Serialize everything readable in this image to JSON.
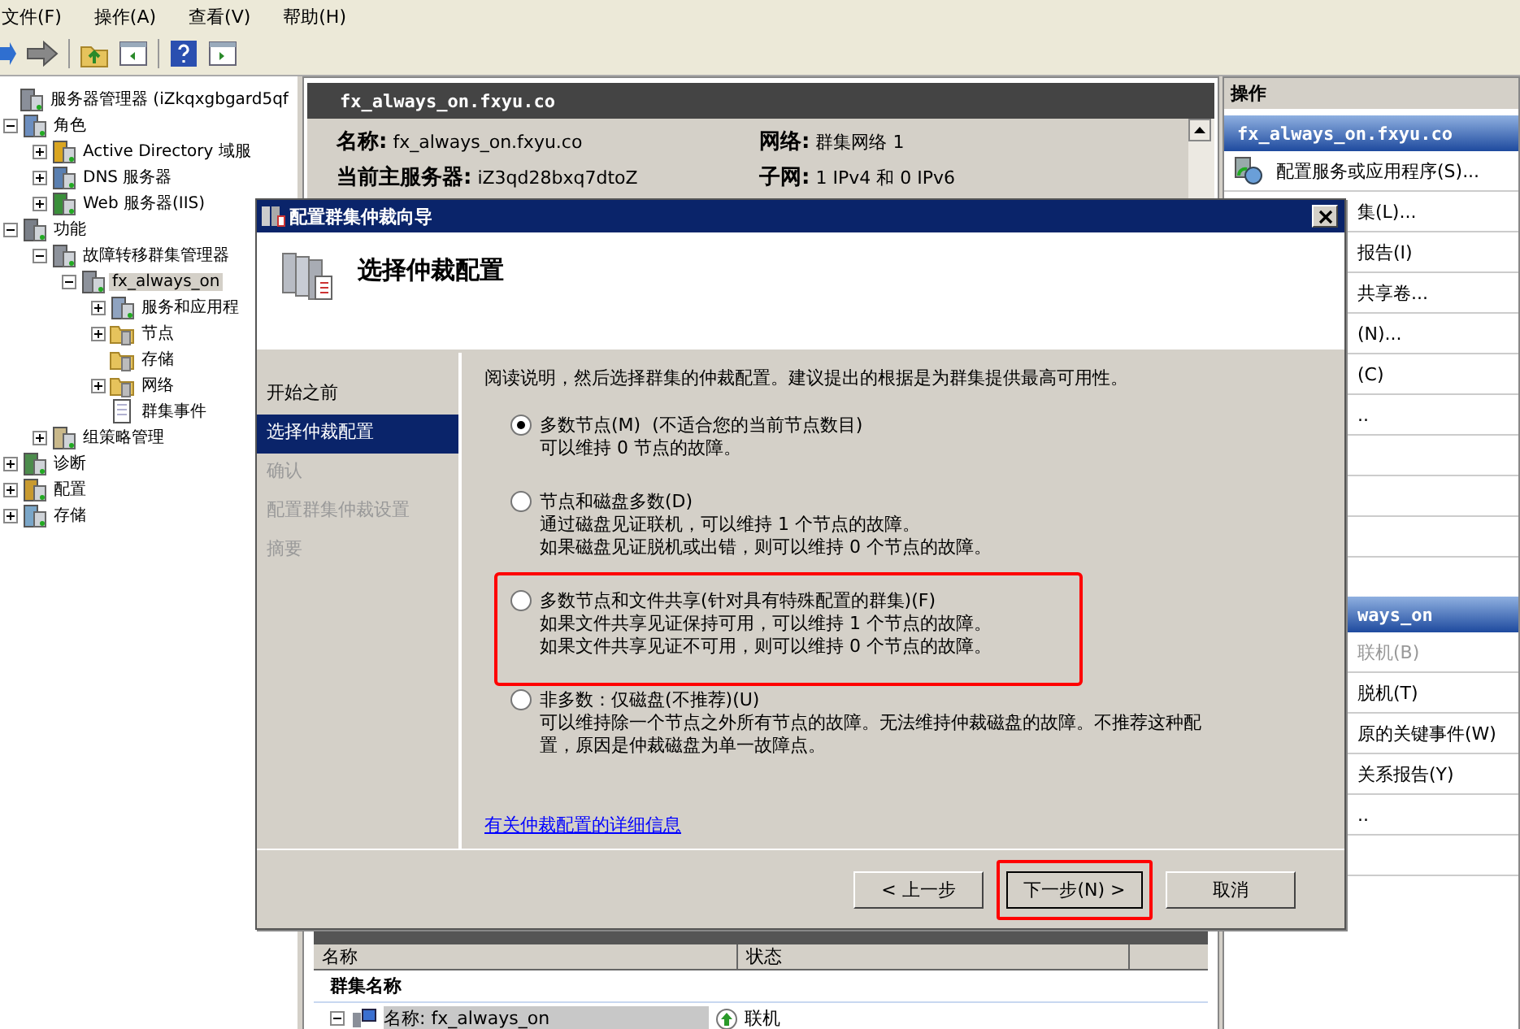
{
  "menu": [
    "文件(F)",
    "操作(A)",
    "查看(V)",
    "帮助(H)"
  ],
  "tree": [
    {
      "label": "服务器管理器 (iZkqxgbgard5qf",
      "kind": "server",
      "children": [
        {
          "label": "角色",
          "kind": "roles",
          "expanded": true,
          "children": [
            {
              "label": "Active Directory 域服",
              "kind": "ad",
              "expanded": false
            },
            {
              "label": "DNS 服务器",
              "kind": "dns",
              "expanded": false
            },
            {
              "label": "Web 服务器(IIS)",
              "kind": "web",
              "expanded": false
            }
          ]
        },
        {
          "label": "功能",
          "kind": "features",
          "expanded": true,
          "children": [
            {
              "label": "故障转移群集管理器",
              "kind": "cluster",
              "expanded": true,
              "children": [
                {
                  "label": "fx_always_on",
                  "kind": "cluster",
                  "expanded": true,
                  "selected": true,
                  "children": [
                    {
                      "label": "服务和应用程",
                      "kind": "apps",
                      "expanded": false,
                      "selected": false
                    },
                    {
                      "label": "节点",
                      "kind": "folder",
                      "expanded": false,
                      "selected": false
                    },
                    {
                      "label": "存储",
                      "kind": "folder",
                      "selected": false
                    },
                    {
                      "label": "网络",
                      "kind": "folder",
                      "expanded": false,
                      "selected": false
                    },
                    {
                      "label": "群集事件",
                      "kind": "log",
                      "selected": false
                    }
                  ]
                }
              ]
            },
            {
              "label": "组策略管理",
              "kind": "policy",
              "expanded": false
            }
          ]
        },
        {
          "label": "诊断",
          "kind": "diag",
          "expanded": false
        },
        {
          "label": "配置",
          "kind": "config",
          "expanded": false
        },
        {
          "label": "存储",
          "kind": "storage",
          "expanded": false
        }
      ]
    }
  ],
  "details": {
    "title": "fx_always_on.fxyu.co",
    "fields": [
      {
        "label": "名称:",
        "value": "fx_always_on.fxyu.co"
      },
      {
        "label": "网络:",
        "value": "群集网络 1"
      },
      {
        "label": "当前主服务器:",
        "value": "iZ3qd28bxq7dtoZ"
      },
      {
        "label": "子网:",
        "value": "1 IPv4 和 0 IPv6"
      }
    ]
  },
  "resources": {
    "columns": [
      "名称",
      "状态"
    ],
    "group": "群集名称",
    "rows": [
      {
        "name": "名称: fx_always_on",
        "status": "联机"
      }
    ]
  },
  "actions": {
    "title": "操作",
    "sections": [
      {
        "title": "fx_always_on.fxyu.co",
        "items": [
          {
            "label": "配置服务或应用程序(S)...",
            "kind": "full",
            "disabled": false
          },
          {
            "label": "集(L)...",
            "kind": "partial",
            "disabled": false
          },
          {
            "label": "报告(I)",
            "kind": "partial",
            "disabled": false
          },
          {
            "label": "共享卷...",
            "kind": "partial",
            "disabled": false
          },
          {
            "label": "(N)...",
            "kind": "partial",
            "disabled": false
          },
          {
            "label": "(C)",
            "kind": "partial",
            "disabled": false
          },
          {
            "label": "..",
            "kind": "partial",
            "disabled": false
          }
        ]
      },
      {
        "title": "ways_on",
        "items": [
          {
            "label": "联机(B)",
            "kind": "partial",
            "disabled": true
          },
          {
            "label": "脱机(T)",
            "kind": "partial",
            "disabled": false
          },
          {
            "label": "原的关键事件(W)",
            "kind": "partial",
            "disabled": false
          },
          {
            "label": "关系报告(Y)",
            "kind": "partial",
            "disabled": false
          },
          {
            "label": "..",
            "kind": "partial",
            "disabled": false
          }
        ]
      }
    ]
  },
  "dialog": {
    "title": "配置群集仲裁向导",
    "heading": "选择仲裁配置",
    "steps": [
      {
        "label": "开始之前",
        "selected": false,
        "disabled": false
      },
      {
        "label": "选择仲裁配置",
        "selected": true,
        "disabled": false
      },
      {
        "label": "确认",
        "selected": false,
        "disabled": true
      },
      {
        "label": "配置群集仲裁设置",
        "selected": false,
        "disabled": true
      },
      {
        "label": "摘要",
        "selected": false,
        "disabled": true
      }
    ],
    "intro": "阅读说明，然后选择群集的仲裁配置。建议提出的根据是为群集提供最高可用性。",
    "options": [
      {
        "label": "多数节点(M)",
        "note": "(不适合您的当前节点数目)",
        "selected": true,
        "description": [
          "可以维持 0 节点的故障。"
        ]
      },
      {
        "label": "节点和磁盘多数(D)",
        "selected": false,
        "description": [
          "通过磁盘见证联机，可以维持 1 个节点的故障。",
          "如果磁盘见证脱机或出错，则可以维持 0 个节点的故障。"
        ]
      },
      {
        "label": "多数节点和文件共享(针对具有特殊配置的群集)(F)",
        "selected": false,
        "highlighted": true,
        "description": [
          "如果文件共享见证保持可用，可以维持 1 个节点的故障。",
          "如果文件共享见证不可用，则可以维持 0 个节点的故障。"
        ]
      },
      {
        "label": "非多数：仅磁盘(不推荐)(U)",
        "selected": false,
        "description": [
          "可以维持除一个节点之外所有节点的故障。无法维持仲裁磁盘的故障。不推荐这种配",
          "置，原因是仲裁磁盘为单一故障点。"
        ]
      }
    ],
    "link": "有关仲裁配置的详细信息",
    "buttons": [
      {
        "label": "< 上一步",
        "default": false
      },
      {
        "label": "下一步(N) >",
        "default": true,
        "highlighted": true
      },
      {
        "label": "取消",
        "default": false
      }
    ]
  }
}
